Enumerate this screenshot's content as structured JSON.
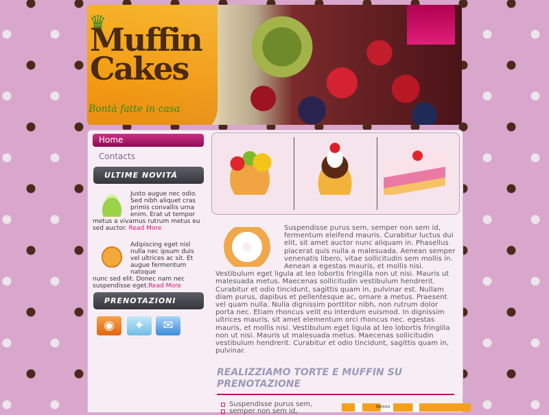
{
  "header": {
    "logo_line1": "Muffin",
    "logo_line2": "Cakes",
    "tagline": "Bontà fatte in casa"
  },
  "nav": {
    "items": [
      {
        "label": "Home",
        "active": true
      },
      {
        "label": "Contacts",
        "active": false
      }
    ]
  },
  "sidebar": {
    "news_title": "ULTIME NOVITÁ",
    "news": [
      {
        "thumb": "cake-icon",
        "text_wrapped": "Justo augue nec odio. Sed nibh aliquet cras primis convallis urna enim. Erat ut tempor",
        "text_full": "metus a vivamus rutrum metus eu sed auctor.",
        "link": "Read More"
      },
      {
        "thumb": "croissant-icon",
        "text_wrapped": "Adipiscing eget nisl nulla nec ipsum duis vel ultrices ac sit. Et augue fermentum natoque",
        "text_full": "nunc sed elit. Donec nam nec suspendisse eget.",
        "link": "Read More"
      }
    ],
    "booking_title": "PRENOTAZIONI",
    "social": [
      {
        "name": "rss-icon",
        "glyph": "◉"
      },
      {
        "name": "twitter-icon",
        "glyph": "✦"
      },
      {
        "name": "mail-icon",
        "glyph": "✉"
      }
    ]
  },
  "main": {
    "gallery": [
      "fruit-tart-image",
      "chocolate-cake-image",
      "cake-slice-image"
    ],
    "article_text": "Suspendisse purus sem, semper non sem id, fermentum eleifend mauris. Curabitur luctus dui elit, sit amet auctor nunc aliquam in. Phasellus placerat quis nulla a malesuada. Aenean semper venenatis libero, vitae sollicitudin sem mollis in. Aenean a egestas mauris, et mollis nisi. Vestibulum eget ligula at leo lobortis fringilla non ut nisi. Mauris ut malesuada metus. Maecenas sollicitudin vestibulum hendrerit. Curabitur et odio tincidunt, sagittis quam in, pulvinar est. Nullam diam purus, dapibus et pellentesque ac, ornare a metus. Praesent vel quam nulla. Nulla dignissim porttitor nibh, non rutrum dolor porta nec. Etiam rhoncus velit eu interdum euismod. In dignissim ultrices mauris, sit amet elementum orci rhoncus nec.  egestas mauris, et mollis nisi. Vestibulum eget ligula at leo lobortis fringilla non ut nisi. Mauris ut malesuada metus. Maecenas sollicitudin vestibulum hendrerit. Curabitur et odio tincidunt, sagittis quam in, pulvinar.",
    "section_title": "REALIZZIAMO TORTE E MUFFIN SU PRENOTAZIONE",
    "bullets": [
      "Suspendisse purus sem,",
      "semper non sem id,"
    ],
    "map_label": "Nenni"
  },
  "colors": {
    "background": "#d9a6cc",
    "accent": "#c20f63",
    "link": "#d3146a",
    "sidebar_header": "#4a4a52"
  }
}
